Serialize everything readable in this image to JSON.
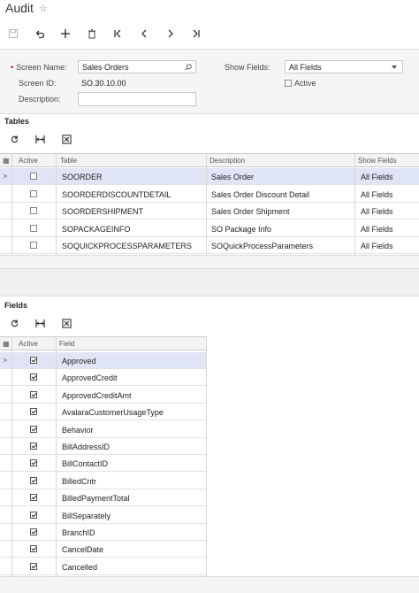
{
  "header": {
    "title": "Audit",
    "star_icon": "star-icon"
  },
  "toolbar": {
    "buttons": [
      {
        "name": "save-icon",
        "interactable": false
      },
      {
        "name": "undo-icon"
      },
      {
        "name": "add-icon"
      },
      {
        "name": "delete-icon"
      },
      {
        "name": "first-icon"
      },
      {
        "name": "previous-icon"
      },
      {
        "name": "next-icon"
      },
      {
        "name": "last-icon"
      }
    ]
  },
  "form": {
    "screen_name_label": "Screen Name:",
    "screen_name_value": "Sales Orders",
    "screen_id_label": "Screen ID:",
    "screen_id_value": "SO.30.10.00",
    "description_label": "Description:",
    "description_value": "",
    "show_fields_label": "Show Fields:",
    "show_fields_value": "All Fields",
    "active_label": "Active",
    "active_checked": false
  },
  "tables": {
    "title": "Tables",
    "columns": [
      "Active",
      "Table",
      "Description",
      "Show Fields"
    ],
    "rows": [
      {
        "active": false,
        "table": "SOORDER",
        "description": "Sales Order",
        "show": "All Fields",
        "selected": true
      },
      {
        "active": false,
        "table": "SOORDERDISCOUNTDETAIL",
        "description": "Sales Order Discount Detail",
        "show": "All Fields"
      },
      {
        "active": false,
        "table": "SOORDERSHIPMENT",
        "description": "Sales Order Shipment",
        "show": "All Fields"
      },
      {
        "active": false,
        "table": "SOPACKAGEINFO",
        "description": "SO Package Info",
        "show": "All Fields"
      },
      {
        "active": false,
        "table": "SOQUICKPROCESSPARAMETERS",
        "description": "SOQuickProcessParameters",
        "show": "All Fields"
      }
    ]
  },
  "fields": {
    "title": "Fields",
    "columns": [
      "Active",
      "Field"
    ],
    "rows": [
      {
        "active": true,
        "field": "Approved",
        "selected": true
      },
      {
        "active": true,
        "field": "ApprovedCredit"
      },
      {
        "active": true,
        "field": "ApprovedCreditAmt"
      },
      {
        "active": true,
        "field": "AvalaraCustomerUsageType"
      },
      {
        "active": true,
        "field": "Behavior"
      },
      {
        "active": true,
        "field": "BillAddressID"
      },
      {
        "active": true,
        "field": "BillContactID"
      },
      {
        "active": true,
        "field": "BilledCntr"
      },
      {
        "active": true,
        "field": "BilledPaymentTotal"
      },
      {
        "active": true,
        "field": "BillSeparately"
      },
      {
        "active": true,
        "field": "BranchID"
      },
      {
        "active": true,
        "field": "CancelDate"
      },
      {
        "active": true,
        "field": "Cancelled"
      }
    ]
  }
}
